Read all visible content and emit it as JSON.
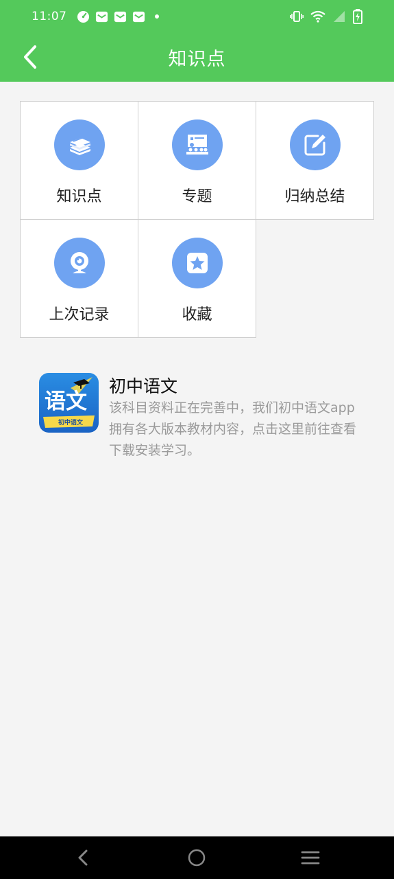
{
  "status": {
    "time": "11:07"
  },
  "header": {
    "title": "知识点"
  },
  "grid": {
    "items": [
      {
        "label": "知识点",
        "icon": "books-icon"
      },
      {
        "label": "专题",
        "icon": "classroom-icon"
      },
      {
        "label": "归纳总结",
        "icon": "edit-note-icon"
      },
      {
        "label": "上次记录",
        "icon": "webcam-icon"
      },
      {
        "label": "收藏",
        "icon": "star-icon"
      }
    ]
  },
  "promo": {
    "title": "初中语文",
    "description": "该科目资料正在完善中，我们初中语文app拥有各大版本教材内容，点击这里前往查看下载安装学习。",
    "icon_text": "语文",
    "icon_subtext": "初中语文"
  },
  "colors": {
    "header": "#54c95b",
    "icon_circle": "#6fa3f1",
    "background": "#f4f4f4"
  }
}
